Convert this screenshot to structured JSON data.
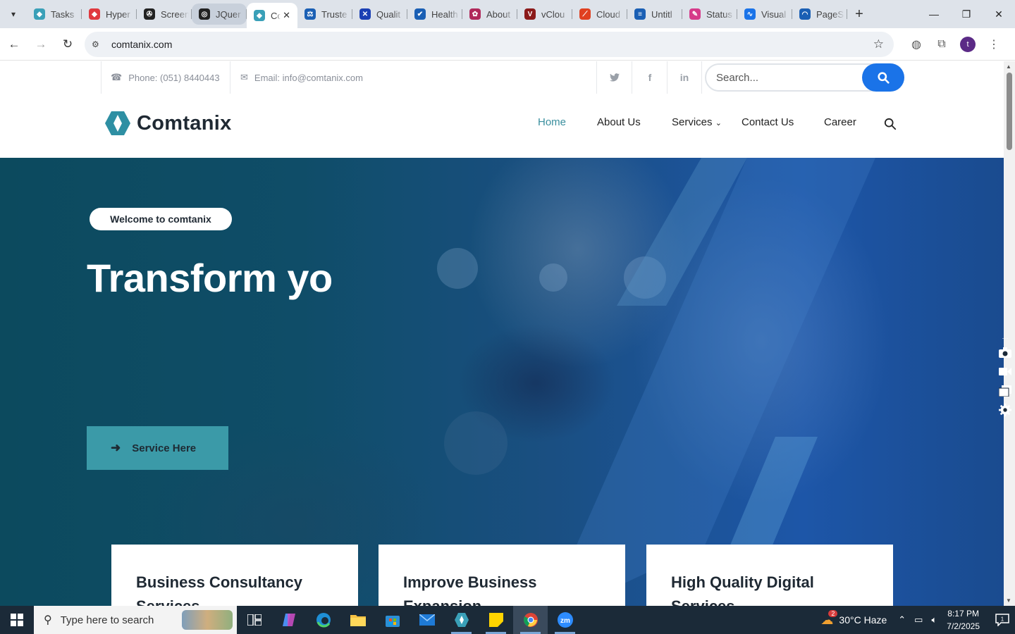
{
  "browser": {
    "tabs": [
      {
        "label": "Tasks",
        "color": "#3aa0b8",
        "glyph": "◆"
      },
      {
        "label": "Hyper",
        "color": "#e0393e",
        "glyph": "◆"
      },
      {
        "label": "Screen",
        "color": "#222222",
        "glyph": "✇"
      },
      {
        "label": "JQuer",
        "color": "#222222",
        "glyph": "◎"
      },
      {
        "label": "Co",
        "color": "#3aa0b8",
        "glyph": "◆"
      },
      {
        "label": "Truste",
        "color": "#1a5fb4",
        "glyph": "⚖"
      },
      {
        "label": "Qualit",
        "color": "#1a3fb4",
        "glyph": "✕"
      },
      {
        "label": "Health",
        "color": "#1a5fb4",
        "glyph": "✔"
      },
      {
        "label": "About",
        "color": "#b0285a",
        "glyph": "✿"
      },
      {
        "label": "vClou",
        "color": "#8b1a1a",
        "glyph": "V"
      },
      {
        "label": "Cloud",
        "color": "#e04020",
        "glyph": "⟋"
      },
      {
        "label": "Untitl",
        "color": "#1a5fb4",
        "glyph": "≡"
      },
      {
        "label": "Status",
        "color": "#d63a8a",
        "glyph": "✎"
      },
      {
        "label": "Visual",
        "color": "#1a73e8",
        "glyph": "∿"
      },
      {
        "label": "PageS",
        "color": "#1a5fb4",
        "glyph": "◠"
      }
    ],
    "url": "comtanix.com",
    "profile_initial": "t"
  },
  "site": {
    "phone": "Phone: (051) 8440443",
    "email": "Email: info@comtanix.com",
    "search_placeholder": "Search...",
    "logo_text": "Comtanix",
    "nav": {
      "home": "Home",
      "about": "About Us",
      "services": "Services",
      "contact": "Contact Us",
      "career": "Career"
    },
    "hero": {
      "badge": "Welcome to comtanix",
      "title": "Transform yo",
      "button": "Service Here"
    },
    "cards": [
      {
        "title": "Business Consultancy Services"
      },
      {
        "title": "Improve Business Expansion"
      },
      {
        "title": "High Quality Digital Services"
      }
    ],
    "accent": "#3a8f9e",
    "search_button_color": "#1a73e8"
  },
  "taskbar": {
    "search_placeholder": "Type here to search",
    "weather": "30°C  Haze",
    "weather_badge": "2",
    "time": "8:17 PM",
    "date": "7/2/2025",
    "notification_count": "1"
  }
}
